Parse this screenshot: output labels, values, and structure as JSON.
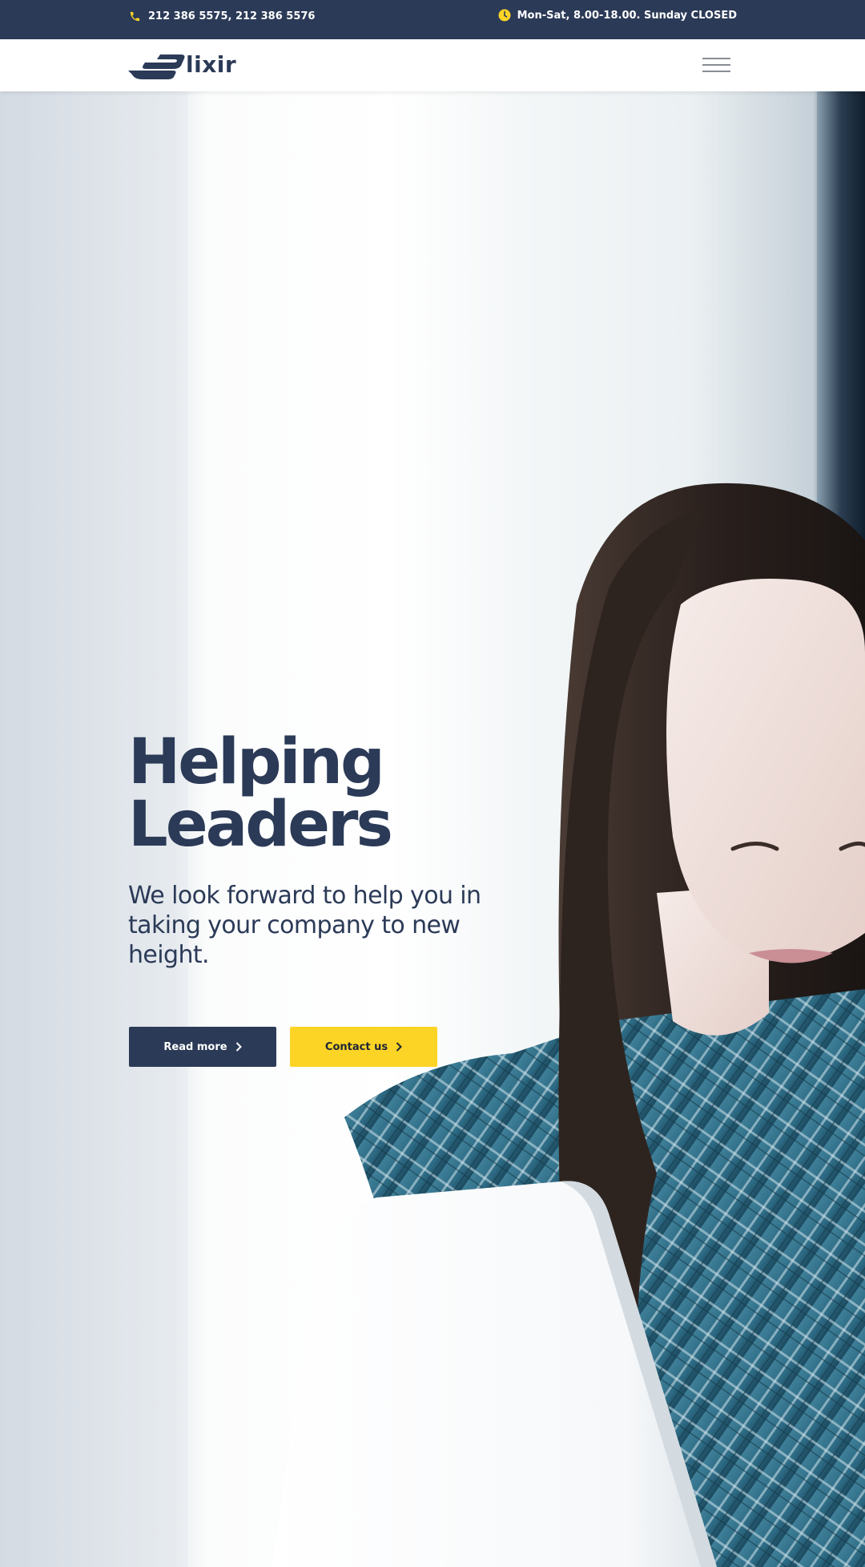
{
  "topbar": {
    "phone_icon": "phone-icon",
    "phone": "212 386 5575, 212 386 5576",
    "hours_icon": "clock-icon",
    "hours": "Mon-Sat, 8.00-18.00. Sunday CLOSED"
  },
  "header": {
    "logo_text": "lixir",
    "menu_icon": "hamburger-menu-icon"
  },
  "hero": {
    "title_line1": "Helping",
    "title_line2": "Leaders",
    "subtitle": "We look forward to help you in taking your company to new height.",
    "read_more_label": "Read more",
    "contact_label": "Contact us",
    "chevron_icon": "chevron-right-icon"
  },
  "colors": {
    "navy": "#2b3a57",
    "accent_yellow": "#fcd426",
    "white": "#ffffff"
  }
}
